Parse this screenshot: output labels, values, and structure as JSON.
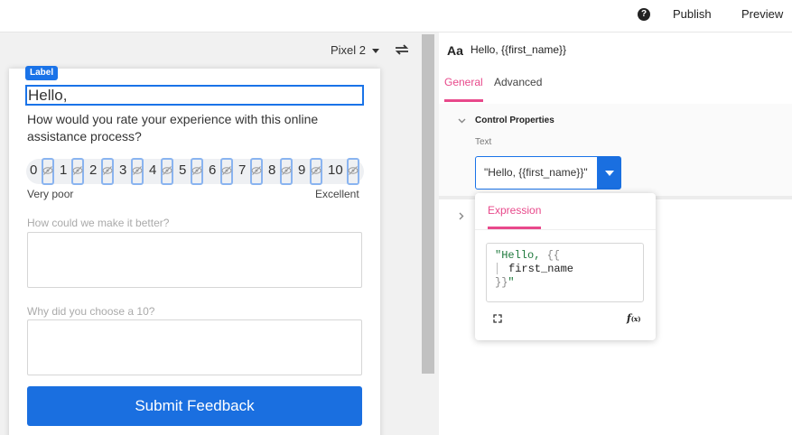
{
  "topbar": {
    "help_icon_glyph": "?",
    "publish_label": "Publish",
    "preview_label": "Preview"
  },
  "canvas": {
    "device_name": "Pixel 2",
    "rotate_icon": "rotate-icon",
    "selected_label_badge": "Label",
    "form": {
      "greeting": "Hello,",
      "question": "How would you rate your experience with this online assistance process?",
      "rating_numbers": [
        "0",
        "1",
        "2",
        "3",
        "4",
        "5",
        "6",
        "7",
        "8",
        "9",
        "10"
      ],
      "scale_low": "Very poor",
      "scale_high": "Excellent",
      "q2_label": "How could we make it better?",
      "q3_label": "Why did you choose a 10?",
      "submit_label": "Submit Feedback"
    }
  },
  "panel": {
    "icon_glyph": "Aa",
    "title": "Hello, {{first_name}}",
    "tabs": [
      {
        "label": "General",
        "active": true
      },
      {
        "label": "Advanced",
        "active": false
      }
    ],
    "section_title": "Control Properties",
    "text_label": "Text",
    "text_value": "\"Hello, {{first_name}}\""
  },
  "popover": {
    "tab_label": "Expression",
    "code_line1_str": "\"Hello, ",
    "code_line1_brace": "{{",
    "code_line2_var": "first_name",
    "code_line3_brace": "}}",
    "code_line3_str": "\"",
    "fx_glyph": "f",
    "fx_sub": "(x)"
  },
  "colors": {
    "accent_blue": "#1a73e8",
    "accent_pink": "#e8498b",
    "submit_blue": "#1a6fe0"
  }
}
